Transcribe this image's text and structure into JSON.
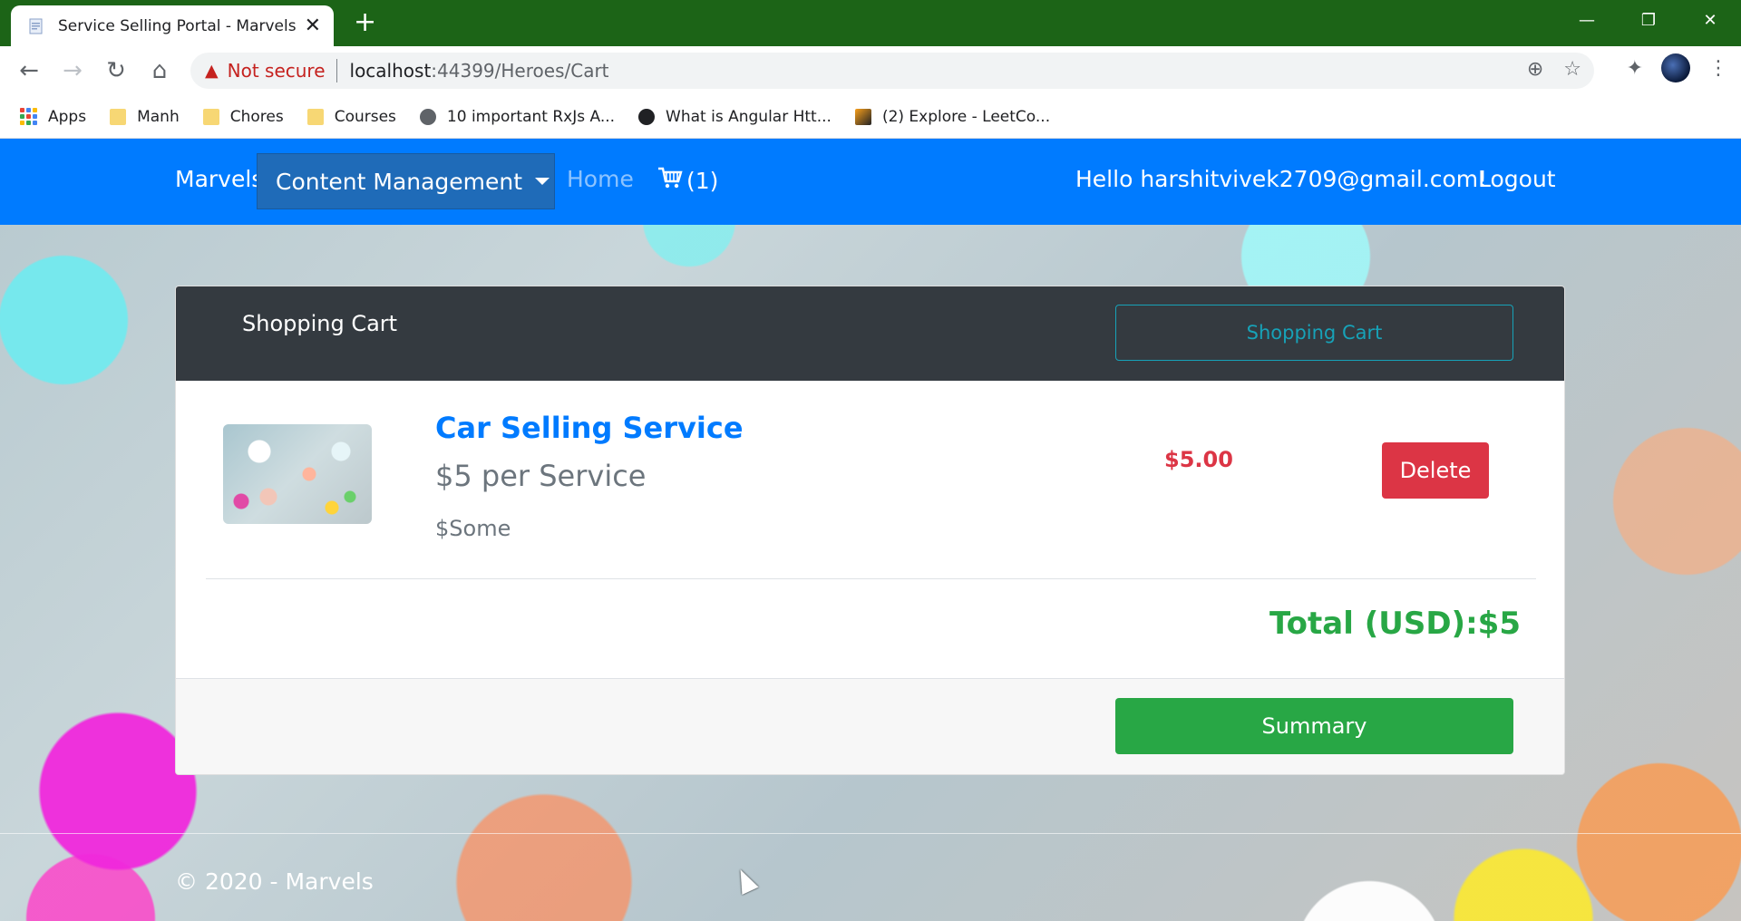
{
  "browser": {
    "tab_title": "Service Selling Portal - Marvels",
    "new_tab": "+",
    "address": {
      "warning": "Not secure",
      "host": "localhost",
      "path": ":44399/Heroes/Cart"
    },
    "bookmarks": [
      {
        "label": "Apps",
        "icon": "apps-grid-icon"
      },
      {
        "label": "Manh",
        "icon": "folder-icon"
      },
      {
        "label": "Chores",
        "icon": "folder-icon"
      },
      {
        "label": "Courses",
        "icon": "folder-icon"
      },
      {
        "label": "10 important RxJs A...",
        "icon": "globe-icon"
      },
      {
        "label": "What is Angular Htt...",
        "icon": "site-icon"
      },
      {
        "label": "(2) Explore - LeetCo...",
        "icon": "leetcode-icon"
      }
    ]
  },
  "navbar": {
    "brand": "Marvels",
    "dropdown": "Content Management",
    "home": "Home",
    "cart_count": "(1)",
    "greeting": "Hello harshitvivek2709@gmail.com!",
    "logout": "Logout"
  },
  "cart": {
    "header_title": "Shopping Cart",
    "header_button": "Shopping Cart",
    "items": [
      {
        "name": "Car Selling Service",
        "price_line": "$5 per Service",
        "description": "$Some",
        "amount": "$5.00",
        "delete_label": "Delete"
      }
    ],
    "total": "Total (USD):$5",
    "summary_label": "Summary"
  },
  "footer": {
    "text": "© 2020 - Marvels"
  },
  "colors": {
    "chrome_frame": "#1c6417",
    "navbar": "#007bff",
    "card_header": "#343a40",
    "info": "#17a2b8",
    "danger": "#dc3545",
    "success": "#28a745"
  }
}
